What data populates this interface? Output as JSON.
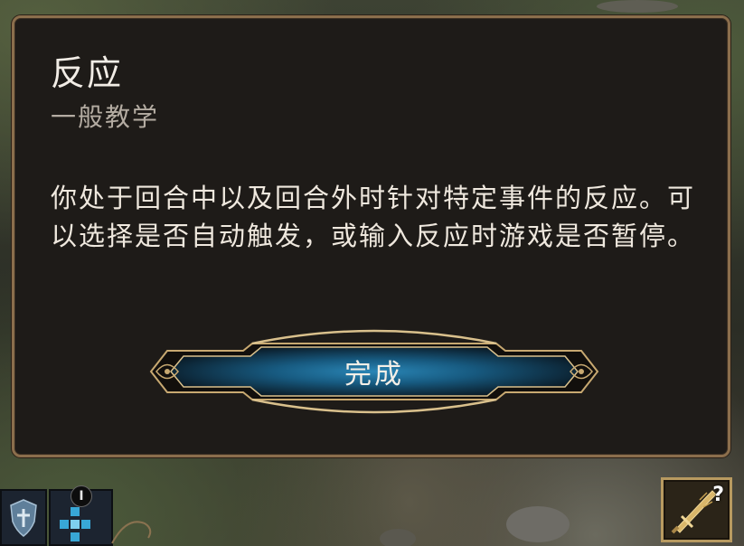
{
  "dialog": {
    "title": "反应",
    "subtitle": "一般教学",
    "body": "你处于回合中以及回合外时针对特定事件的反应。可以选择是否自动触发，或输入反应时游戏是否暂停。",
    "done_label": "完成"
  },
  "hud": {
    "hotbar_badge": "I",
    "help_badge": "?"
  },
  "colors": {
    "dialog_bg": "#1e1b18",
    "dialog_border": "#8b6e4c",
    "button_glow": "#1e6f9a",
    "gold_trim": "#c8a971"
  }
}
